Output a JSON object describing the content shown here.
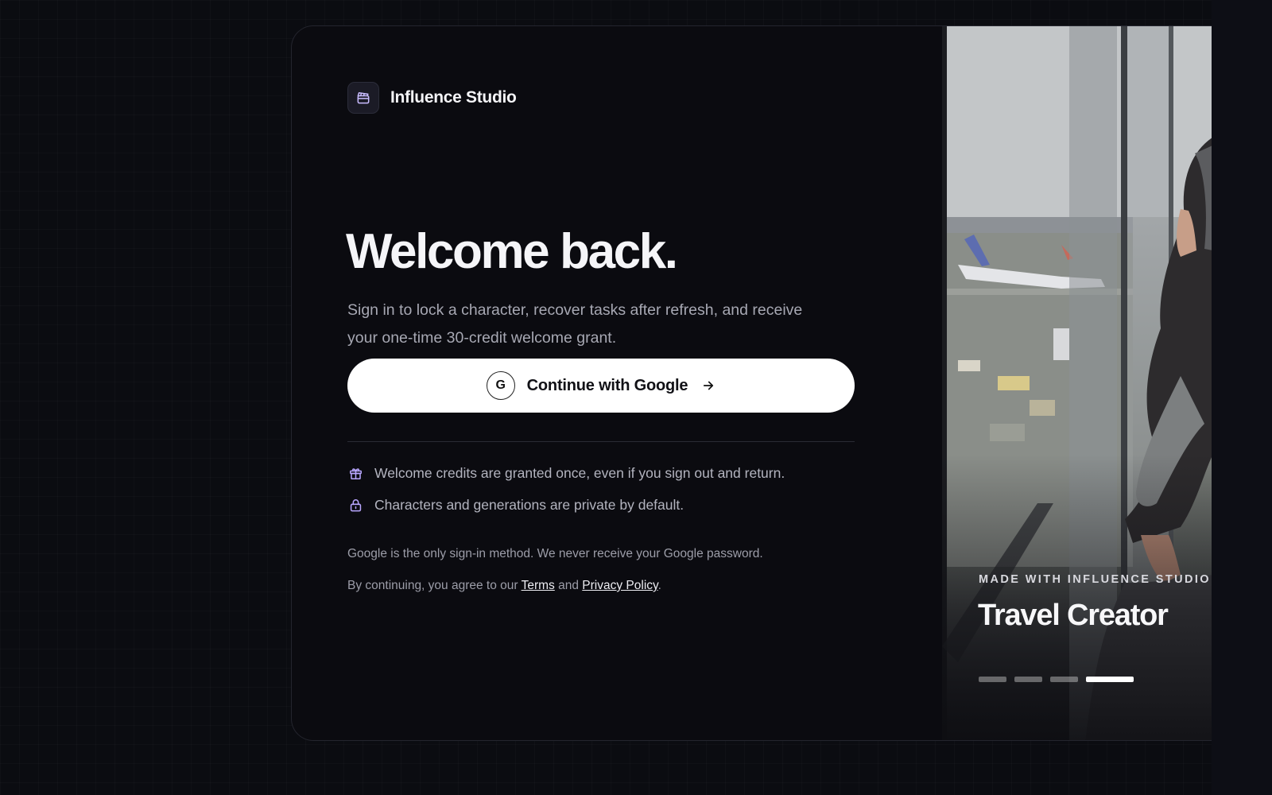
{
  "brand": {
    "name": "Influence Studio",
    "icon": "clapperboard-icon"
  },
  "headline": "Welcome back.",
  "subtitle": "Sign in to lock a character, recover tasks after refresh, and receive your one-time 30-credit welcome grant.",
  "google_button": {
    "icon_letter": "G",
    "label": "Continue with Google",
    "icon": "arrow-right-icon"
  },
  "features": [
    {
      "icon": "gift-icon",
      "text": "Welcome credits are granted once, even if you sign out and return."
    },
    {
      "icon": "lock-icon",
      "text": "Characters and generations are private by default."
    }
  ],
  "notes": {
    "signin_note": "Google is the only sign-in method. We never receive your Google password.",
    "agree_prefix": "By continuing, you agree to our",
    "terms": "Terms",
    "and": "and",
    "privacy": "Privacy Policy",
    "period": "."
  },
  "showcase": {
    "kicker": "MADE WITH INFLUENCE STUDIO",
    "title": "Travel Creator",
    "slides_total": 4,
    "active_slide": 4
  },
  "colors": {
    "background": "#0b0c11",
    "card": "#0b0b10",
    "button": "#ffffff",
    "accent_icon": "#b9a7ff"
  }
}
